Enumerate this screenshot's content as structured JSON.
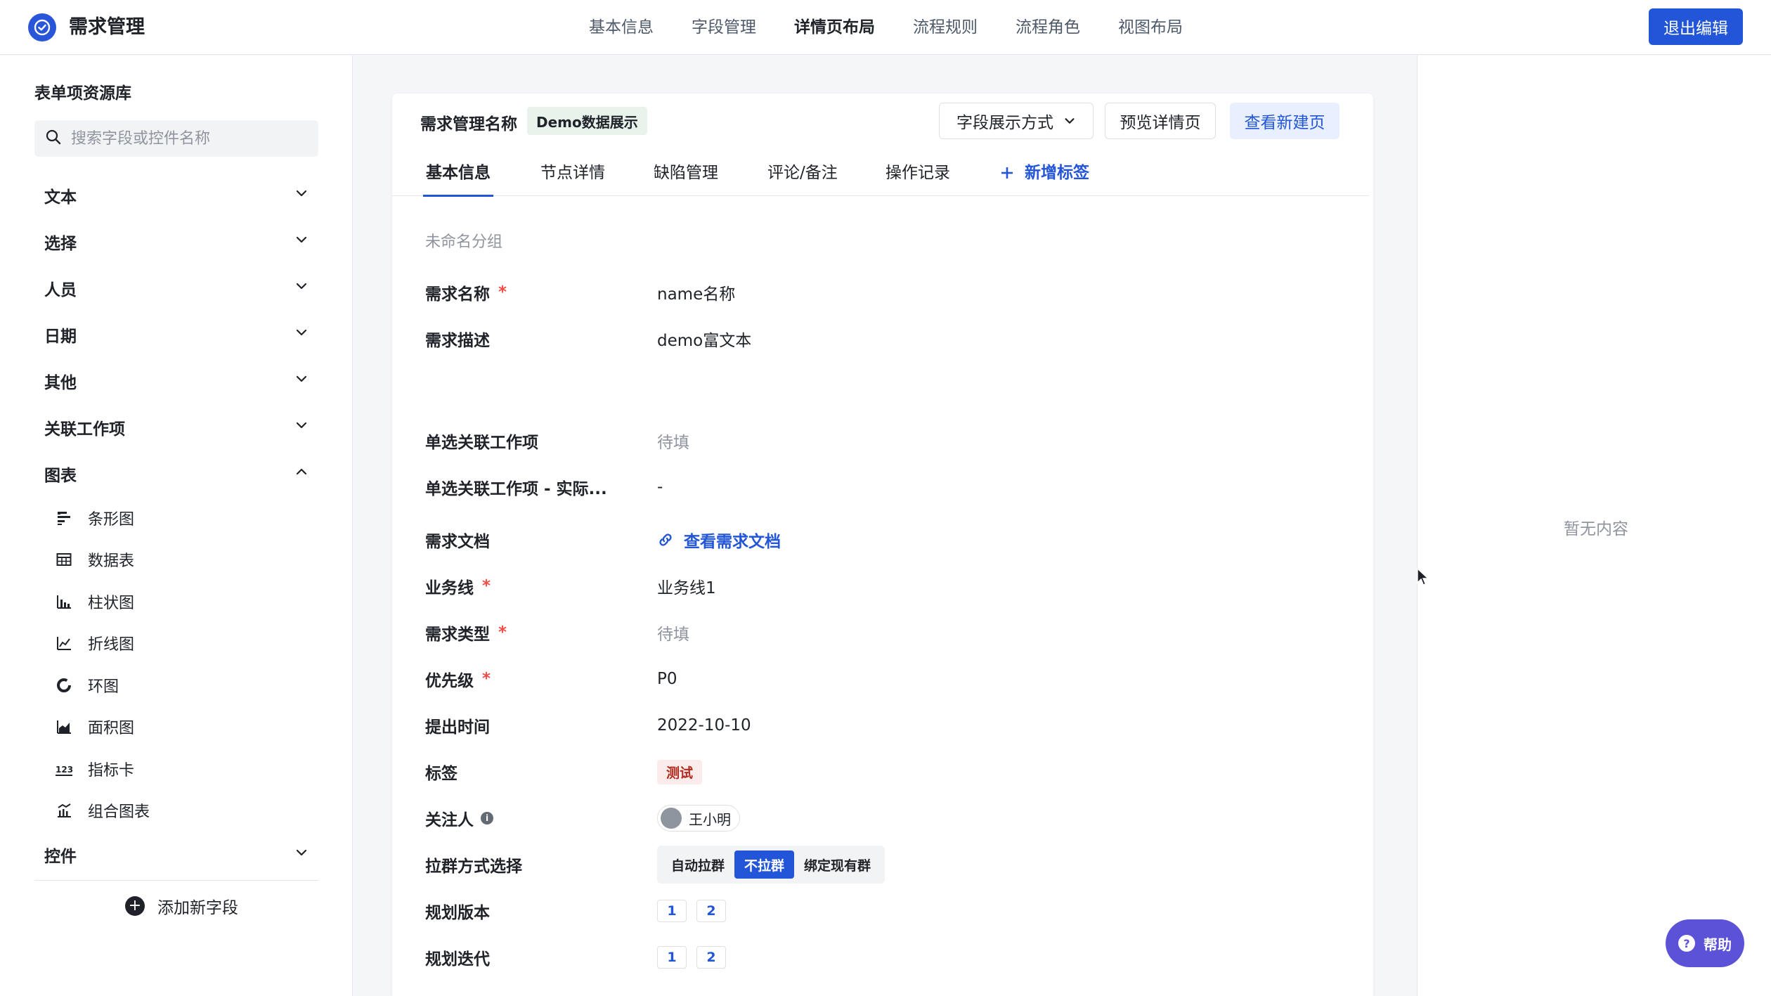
{
  "app": {
    "title": "需求管理"
  },
  "topnav": {
    "items": [
      "基本信息",
      "字段管理",
      "详情页布局",
      "流程规则",
      "流程角色",
      "视图布局"
    ],
    "active_index": 2,
    "exit_label": "退出编辑"
  },
  "sidebar": {
    "title": "表单项资源库",
    "search_placeholder": "搜索字段或控件名称",
    "categories": {
      "text": "文本",
      "select": "选择",
      "person": "人员",
      "date": "日期",
      "other": "其他",
      "related": "关联工作项",
      "chart": "图表",
      "control": "控件"
    },
    "chart_items": [
      "条形图",
      "数据表",
      "柱状图",
      "折线图",
      "环图",
      "面积图",
      "指标卡",
      "组合图表"
    ],
    "add_field_label": "添加新字段"
  },
  "card": {
    "title": "需求管理名称",
    "badge": "Demo数据展示",
    "display_mode_label": "字段展示方式",
    "preview_label": "预览详情页",
    "new_page_label": "查看新建页",
    "tabs": [
      "基本信息",
      "节点详情",
      "缺陷管理",
      "评论/备注",
      "操作记录"
    ],
    "add_tab_label": "新增标签",
    "group_label": "未命名分组",
    "fields": {
      "name": {
        "label": "需求名称",
        "value": "name名称",
        "required": "*"
      },
      "desc": {
        "label": "需求描述",
        "value": "demo富文本"
      },
      "single_rel": {
        "label": "单选关联工作项",
        "value": "待填"
      },
      "single_rel_actual": {
        "label": "单选关联工作项 - 实际...",
        "value": "-"
      },
      "doc": {
        "label": "需求文档",
        "value": "查看需求文档"
      },
      "biz": {
        "label": "业务线",
        "value": "业务线1",
        "required": "*"
      },
      "type": {
        "label": "需求类型",
        "value": "待填",
        "required": "*"
      },
      "priority": {
        "label": "优先级",
        "value": "P0",
        "required": "*"
      },
      "time": {
        "label": "提出时间",
        "value": "2022-10-10"
      },
      "tag": {
        "label": "标签",
        "value": "测试"
      },
      "follower": {
        "label": "关注人",
        "value": "王小明"
      },
      "group_mode": {
        "label": "拉群方式选择",
        "options": [
          "自动拉群",
          "不拉群",
          "绑定现有群"
        ],
        "selected_index": 1
      },
      "plan_version": {
        "label": "规划版本",
        "values": [
          "1",
          "2"
        ]
      },
      "plan_iter": {
        "label": "规划迭代",
        "values": [
          "1",
          "2"
        ]
      }
    }
  },
  "right_panel": {
    "empty_text": "暂无内容"
  },
  "help": {
    "label": "帮助"
  },
  "colors": {
    "primary": "#2255d8",
    "help": "#5b52d8",
    "required": "#f54a45"
  }
}
